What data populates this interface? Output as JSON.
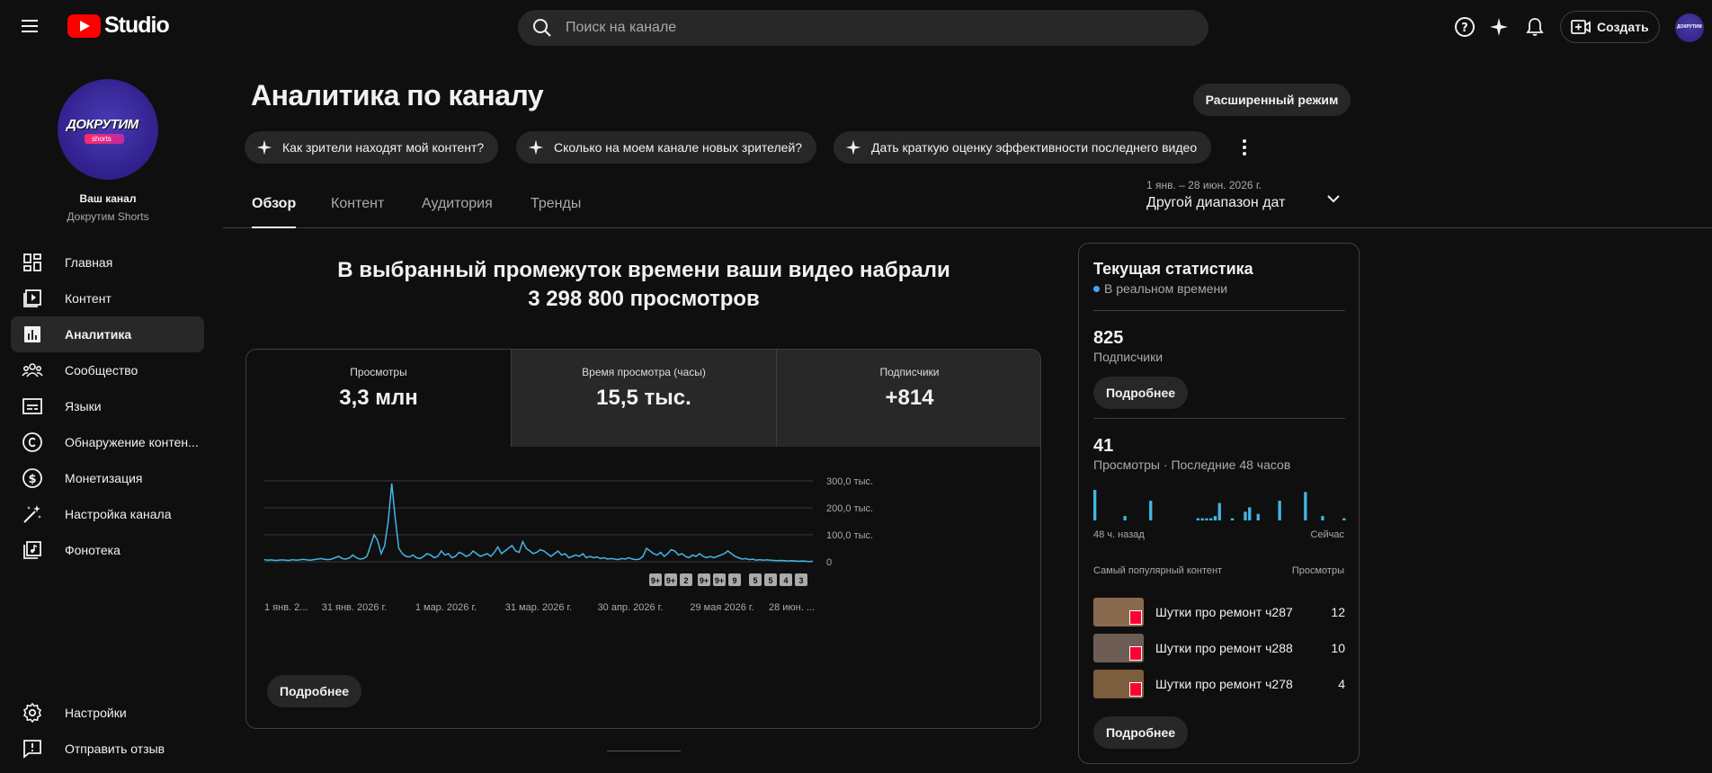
{
  "header": {
    "logo_text": "Studio",
    "search_placeholder": "Поиск на канале",
    "create_label": "Создать",
    "avatar_text": "ДОКРУТИМ"
  },
  "sidebar": {
    "avatar_title": "ДОКРУТИМ",
    "avatar_sub": "shorts",
    "channel_label": "Ваш канал",
    "channel_name": "Докрутим Shorts",
    "items": [
      {
        "label": "Главная",
        "icon": "dashboard-icon"
      },
      {
        "label": "Контент",
        "icon": "content-icon"
      },
      {
        "label": "Аналитика",
        "icon": "analytics-icon",
        "active": true
      },
      {
        "label": "Сообщество",
        "icon": "community-icon"
      },
      {
        "label": "Языки",
        "icon": "subtitles-icon"
      },
      {
        "label": "Обнаружение контен...",
        "icon": "copyright-icon"
      },
      {
        "label": "Монетизация",
        "icon": "dollar-icon"
      },
      {
        "label": "Настройка канала",
        "icon": "magic-wand-icon"
      },
      {
        "label": "Фонотека",
        "icon": "audio-library-icon"
      }
    ],
    "bottom_items": [
      {
        "label": "Настройки",
        "icon": "gear-icon"
      },
      {
        "label": "Отправить отзыв",
        "icon": "feedback-icon"
      }
    ]
  },
  "main": {
    "title": "Аналитика по каналу",
    "advanced_mode": "Расширенный режим",
    "chips": [
      "Как зрители находят мой контент?",
      "Сколько на моем канале новых зрителей?",
      "Дать краткую оценку эффективности последнего видео"
    ],
    "tabs": [
      "Обзор",
      "Контент",
      "Аудитория",
      "Тренды"
    ],
    "date_range_small": "1 янв. – 28 июн. 2026 г.",
    "date_range_label": "Другой диапазон дат",
    "headline_line1": "В выбранный промежуток времени ваши видео набрали",
    "headline_line2": "3 298 800 просмотров",
    "metrics": [
      {
        "label": "Просмотры",
        "value": "3,3 млн"
      },
      {
        "label": "Время просмотра (часы)",
        "value": "15,5 тыс."
      },
      {
        "label": "Подписчики",
        "value": "+814"
      }
    ],
    "details_label": "Подробнее"
  },
  "chart_data": {
    "type": "line",
    "ylim": [
      0,
      300000
    ],
    "y_ticks": [
      "300,0 тыс.",
      "200,0 тыс.",
      "100,0 тыс.",
      "0"
    ],
    "x_tick_labels": [
      "1 янв. 2...",
      "31 янв. 2026 г.",
      "1 мар. 2026 г.",
      "31 мар. 2026 г.",
      "30 апр. 2026 г.",
      "29 мая 2026 г.",
      "28 июн. ..."
    ],
    "series": [
      {
        "values": [
          8000,
          6000,
          7000,
          5000,
          6000,
          7000,
          6000,
          5000,
          8000,
          6000,
          7000,
          9000,
          7000,
          6000,
          8000,
          10000,
          12000,
          9000,
          8000,
          10000,
          15000,
          20000,
          12000,
          10000,
          14000,
          25000,
          15000,
          10000,
          12000,
          20000,
          60000,
          100000,
          80000,
          30000,
          60000,
          150000,
          290000,
          160000,
          50000,
          30000,
          20000,
          18000,
          25000,
          15000,
          12000,
          20000,
          30000,
          25000,
          15000,
          20000,
          40000,
          25000,
          30000,
          15000,
          20000,
          35000,
          30000,
          20000,
          25000,
          40000,
          30000,
          20000,
          25000,
          30000,
          20000,
          35000,
          55000,
          30000,
          40000,
          50000,
          60000,
          40000,
          35000,
          75000,
          50000,
          40000,
          30000,
          35000,
          45000,
          40000,
          30000,
          20000,
          30000,
          40000,
          25000,
          30000,
          15000,
          20000,
          25000,
          20000,
          30000,
          15000,
          20000,
          15000,
          18000,
          12000,
          15000,
          10000,
          12000,
          10000,
          8000,
          12000,
          10000,
          15000,
          10000,
          8000,
          10000,
          20000,
          50000,
          40000,
          30000,
          25000,
          35000,
          20000,
          30000,
          45000,
          40000,
          25000,
          30000,
          20000,
          15000,
          25000,
          20000,
          30000,
          20000,
          15000,
          20000,
          15000,
          20000,
          25000,
          30000,
          40000,
          30000,
          20000,
          15000,
          10000,
          12000,
          8000,
          10000,
          6000,
          8000,
          6000,
          7000,
          6000,
          5000,
          4000,
          5000,
          4000,
          3000,
          4000,
          3000,
          2000,
          3000,
          2000,
          1000,
          2000
        ]
      }
    ],
    "annotations": [
      "9+",
      "9+",
      "2",
      "9+",
      "9+",
      "9",
      "5",
      "5",
      "4",
      "3"
    ],
    "grid": true
  },
  "realtime": {
    "title": "Текущая статистика",
    "live": "В реальном времени",
    "subscribers_value": "825",
    "subscribers_label": "Подписчики",
    "views_value": "41",
    "views_label": "Просмотры · Последние 48 часов",
    "axis_left": "48 ч. назад",
    "axis_right": "Сейчас",
    "top_content_label": "Самый популярный контент",
    "top_content_metric": "Просмотры",
    "details_label": "Подробнее",
    "bars": [
      14,
      0,
      0,
      0,
      0,
      0,
      0,
      2,
      0,
      0,
      0,
      0,
      0,
      9,
      0,
      0,
      0,
      0,
      0,
      0,
      0,
      0,
      0,
      0,
      1,
      1,
      1,
      1,
      2,
      8,
      0,
      0,
      1,
      0,
      0,
      4,
      6,
      0,
      3,
      0,
      0,
      0,
      0,
      9,
      0,
      0,
      0,
      0,
      0,
      13,
      0,
      0,
      0,
      2,
      0,
      0,
      0,
      0,
      1
    ],
    "top_items": [
      {
        "title": "Шутки про ремонт ч287",
        "views": "12",
        "color": "#8a6a4e"
      },
      {
        "title": "Шутки про ремонт ч288",
        "views": "10",
        "color": "#6e5d54"
      },
      {
        "title": "Шутки про ремонт ч278",
        "views": "4",
        "color": "#7a5e3e"
      }
    ]
  }
}
